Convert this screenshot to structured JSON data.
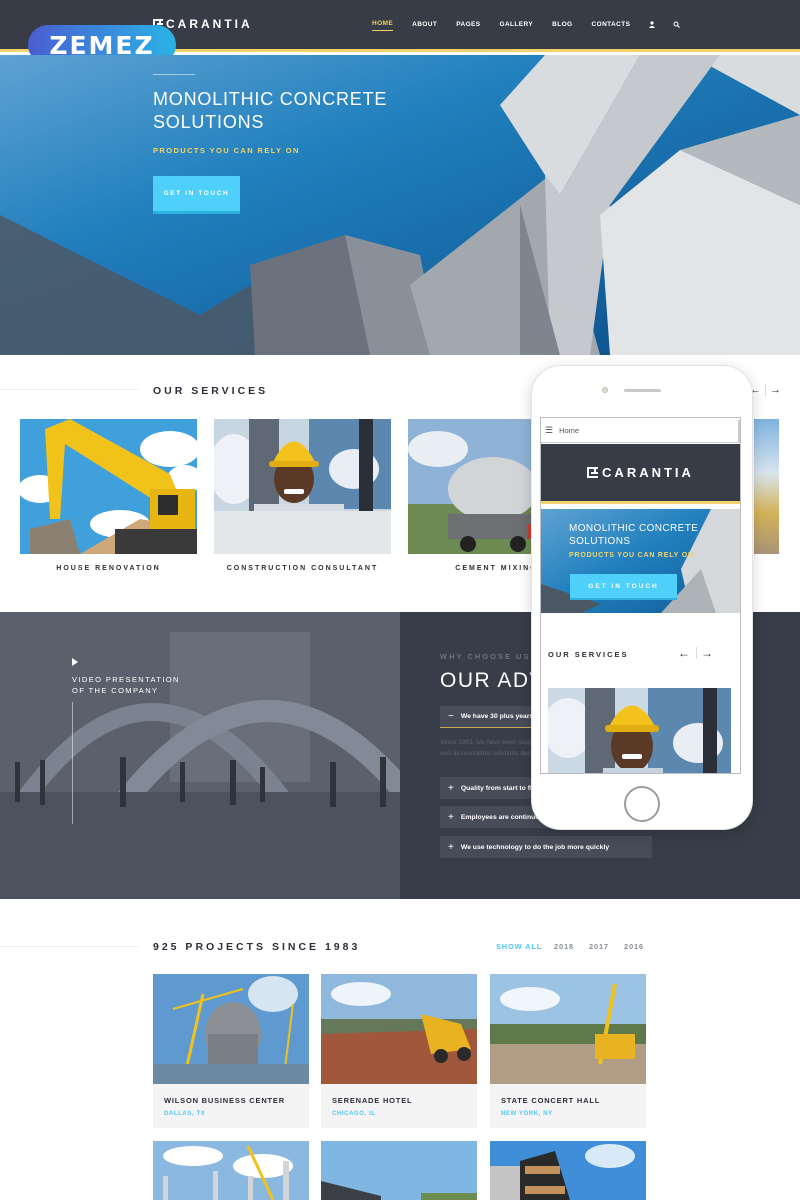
{
  "header": {
    "logo_text": "CARANTIA",
    "nav": [
      {
        "label": "HOME",
        "active": true
      },
      {
        "label": "ABOUT"
      },
      {
        "label": "PAGES"
      },
      {
        "label": "GALLERY"
      },
      {
        "label": "BLOG"
      },
      {
        "label": "CONTACTS"
      }
    ],
    "user_icon": "user-icon",
    "search_icon": "search-icon",
    "accent": "#f3d26a"
  },
  "badge": {
    "text": "ZEMEZ"
  },
  "hero": {
    "title_line1": "MONOLITHIC CONCRETE",
    "title_line2": "SOLUTIONS",
    "subtitle": "PRODUCTS YOU CAN RELY ON",
    "button": "GET IN TOUCH"
  },
  "services": {
    "title": "OUR SERVICES",
    "items": [
      {
        "label": "HOUSE RENOVATION"
      },
      {
        "label": "CONSTRUCTION CONSULTANT"
      },
      {
        "label": "CEMENT MIXING"
      }
    ],
    "prev_icon": "arrow-left-icon",
    "next_icon": "arrow-right-icon"
  },
  "video": {
    "line1": "VIDEO PRESENTATION",
    "line2": "OF THE COMPANY"
  },
  "advantages": {
    "kicker": "WHY CHOOSE US",
    "title": "OUR ADVANTAGES",
    "items": [
      {
        "label": "We have 30 plus years of experience",
        "open": true,
        "sign": "−"
      },
      {
        "label": "Quality from start to finish",
        "sign": "+"
      },
      {
        "label": "Employees are continuously trained",
        "sign": "+"
      },
      {
        "label": "We use technology to do the job more quickly",
        "sign": "+"
      }
    ],
    "open_text": "Since 1983, we have been supplying high quality Portland cement as well as monolithic solutions designed for you."
  },
  "phone": {
    "menu_label": "Home",
    "logo_text": "CARANTIA",
    "hero_title_line1": "MONOLITHIC CONCRETE",
    "hero_title_line2": "SOLUTIONS",
    "hero_sub": "PRODUCTS YOU CAN RELY ON",
    "hero_button": "GET IN TOUCH",
    "services_title": "OUR SERVICES"
  },
  "projects": {
    "title": "925 PROJECTS SINCE 1983",
    "filters": [
      {
        "label": "SHOW ALL",
        "active": true
      },
      {
        "label": "2018"
      },
      {
        "label": "2017"
      },
      {
        "label": "2016"
      }
    ],
    "items": [
      {
        "name": "WILSON BUSINESS CENTER",
        "location": "DALLAS, TX"
      },
      {
        "name": "SERENADE HOTEL",
        "location": "CHICAGO, IL"
      },
      {
        "name": "STATE CONCERT HALL",
        "location": "NEW YORK, NY"
      }
    ]
  }
}
